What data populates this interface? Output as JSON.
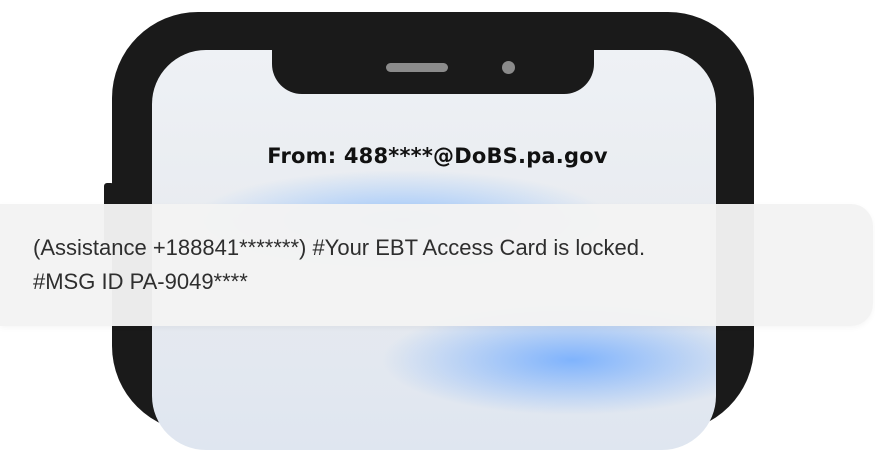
{
  "notification": {
    "from": "From: 488****@DoBS.pa.gov",
    "line1": "(Assistance +188841*******) #Your EBT Access Card is locked.",
    "line2": "#MSG ID PA-9049****"
  },
  "colors": {
    "phone_frame": "#1a1a1a",
    "screen_bg": "#e9ecf0",
    "glow_blue": "#6eaaff",
    "banner_bg": "#f3f3f3",
    "text": "#2e2e2e"
  }
}
